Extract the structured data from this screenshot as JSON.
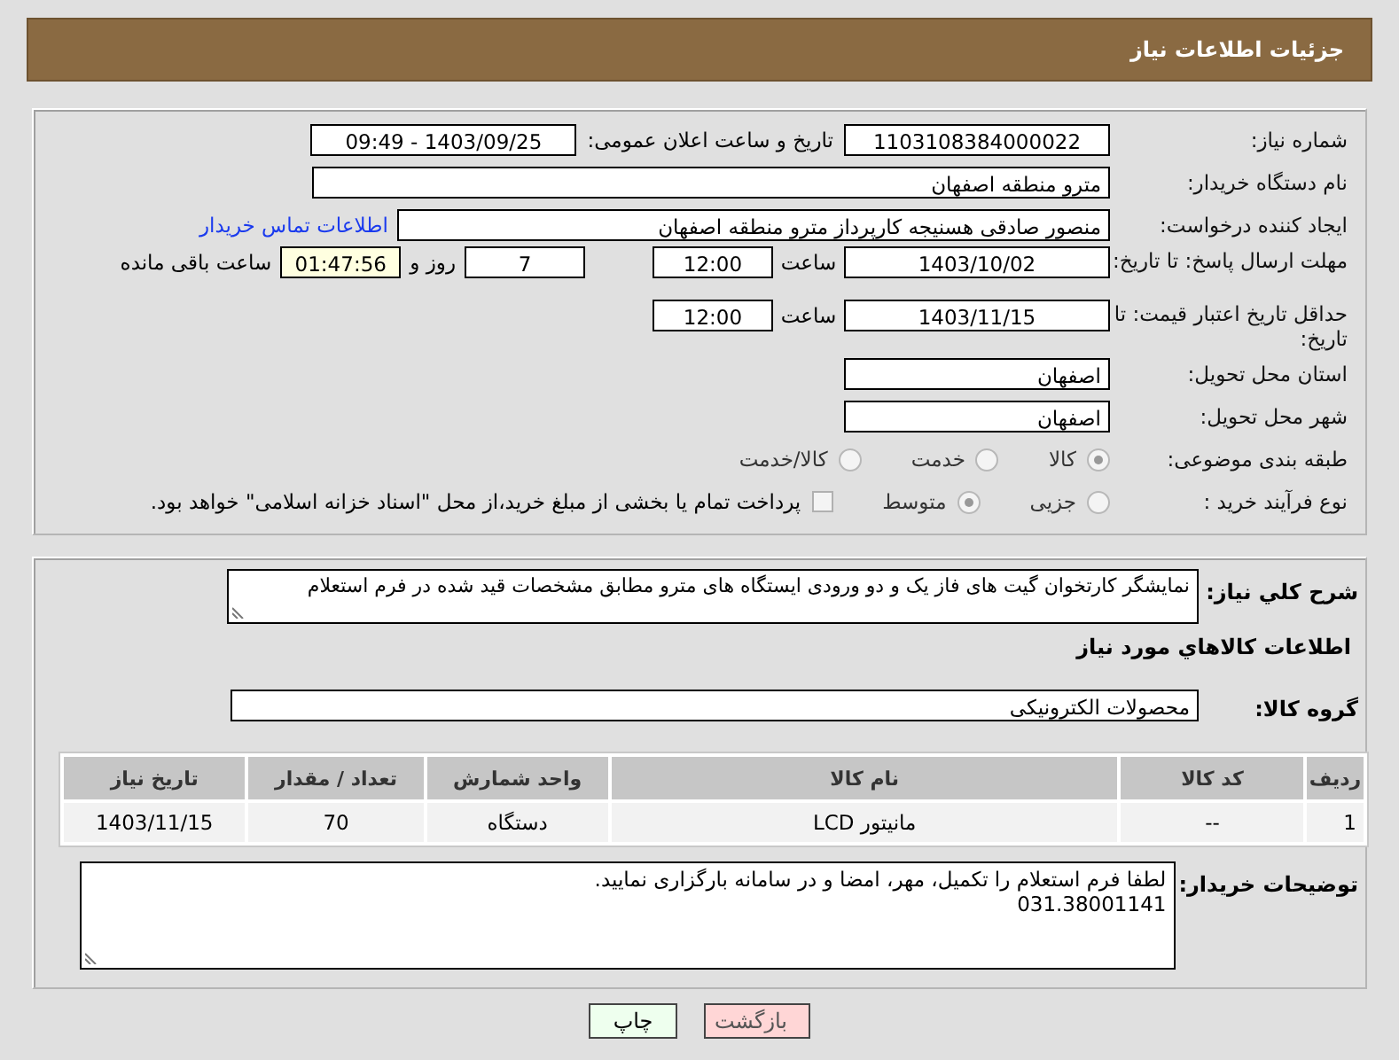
{
  "header": {
    "title": "جزئیات اطلاعات نیاز"
  },
  "info": {
    "need_number": {
      "label": "شماره نیاز:",
      "value": "1103108384000022"
    },
    "announce": {
      "label": "تاریخ و ساعت اعلان عمومی:",
      "value": "1403/09/25 - 09:49"
    },
    "buyer": {
      "label": "نام دستگاه خریدار:",
      "value": "مترو منطقه اصفهان"
    },
    "creator": {
      "label": "ایجاد کننده درخواست:",
      "value": "منصور صادقی هسنیجه کارپرداز مترو منطقه اصفهان",
      "link": "اطلاعات تماس خریدار"
    },
    "deadline": {
      "label": "مهلت ارسال پاسخ: تا تاریخ:",
      "date": "1403/10/02",
      "time_label": "ساعت",
      "time": "12:00",
      "days": "7",
      "days_label": "روز و",
      "remaining": "01:47:56",
      "remaining_label": "ساعت باقی مانده"
    },
    "validity": {
      "label": "حداقل تاریخ اعتبار قیمت: تا تاریخ:",
      "date": "1403/11/15",
      "time_label": "ساعت",
      "time": "12:00"
    },
    "province": {
      "label": "استان محل تحویل:",
      "value": "اصفهان"
    },
    "city": {
      "label": "شهر محل تحویل:",
      "value": "اصفهان"
    },
    "category": {
      "label": "طبقه بندی موضوعی:",
      "options": [
        {
          "label": "کالا",
          "selected": true
        },
        {
          "label": "خدمت",
          "selected": false
        },
        {
          "label": "کالا/خدمت",
          "selected": false
        }
      ]
    },
    "process": {
      "label": "نوع فرآیند خرید :",
      "options": [
        {
          "label": "جزیی",
          "selected": false
        },
        {
          "label": "متوسط",
          "selected": true
        }
      ],
      "treasury": {
        "label": "پرداخت تمام یا بخشی از مبلغ خرید،از محل \"اسناد خزانه اسلامی\" خواهد بود.",
        "checked": false
      }
    }
  },
  "details": {
    "description": {
      "label": "شرح کلي نياز:",
      "value": "نمایشگر کارتخوان گیت های فاز یک و دو ورودی ایستگاه های مترو مطابق مشخصات قید شده در فرم استعلام"
    },
    "goods_title": "اطلاعات کالاهاي مورد نياز",
    "group": {
      "label": "گروه کالا:",
      "value": "محصولات الکترونیکی"
    },
    "table": {
      "columns": [
        "ردیف",
        "کد کالا",
        "نام کالا",
        "واحد شمارش",
        "تعداد / مقدار",
        "تاریخ نیاز"
      ],
      "rows": [
        [
          "1",
          "--",
          "مانیتور LCD",
          "دستگاه",
          "70",
          "1403/11/15"
        ]
      ]
    },
    "notes": {
      "label": "توضیحات خریدار:",
      "lines": [
        "لطفا فرم استعلام را تکمیل، مهر، امضا و در سامانه بارگزاری نمایید.",
        "031.38001141"
      ]
    }
  },
  "buttons": [
    {
      "kind": "back",
      "label": "بازگشت"
    },
    {
      "kind": "print",
      "label": "چاپ"
    }
  ]
}
